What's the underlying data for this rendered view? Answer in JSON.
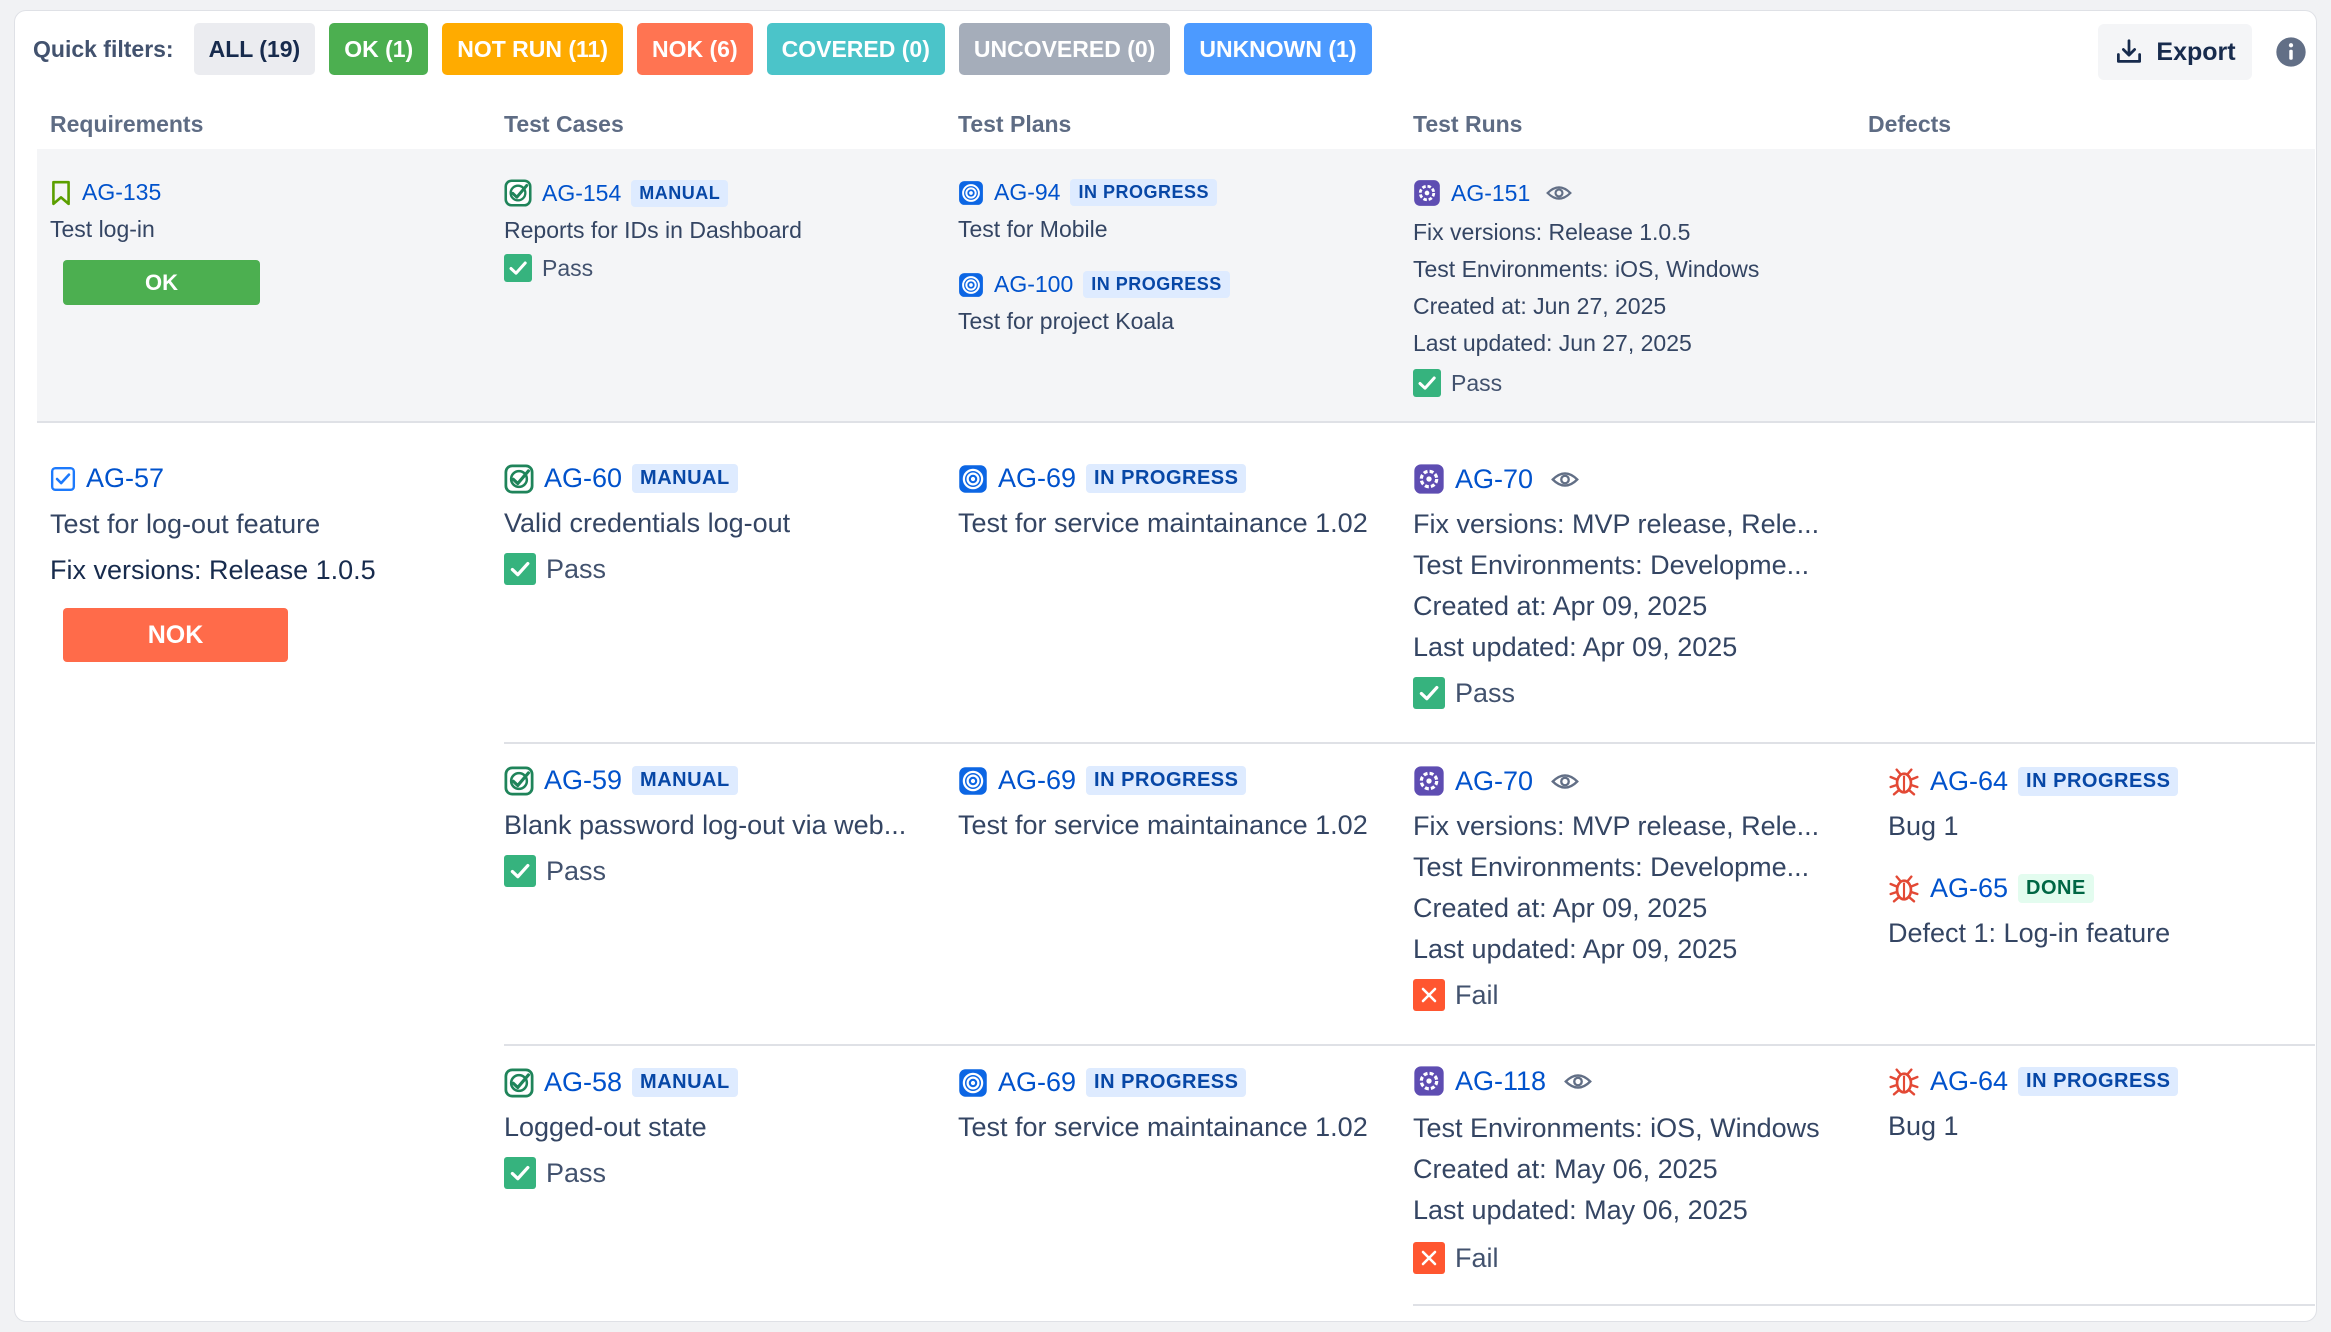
{
  "filters": {
    "label": "Quick filters:",
    "chips": [
      {
        "label": "ALL (19)",
        "color": "#ebecf0"
      },
      {
        "label": "OK (1)",
        "color": "#4caf50"
      },
      {
        "label": "NOT RUN (11)",
        "color": "#ffab00"
      },
      {
        "label": "NOK (6)",
        "color": "#ff7452"
      },
      {
        "label": "COVERED (0)",
        "color": "#4bc4c9"
      },
      {
        "label": "UNCOVERED (0)",
        "color": "#a5adba"
      },
      {
        "label": "UNKNOWN (1)",
        "color": "#4c9aff"
      }
    ],
    "export_label": "Export"
  },
  "columns": [
    "Requirements",
    "Test Cases",
    "Test Plans",
    "Test Runs",
    "Defects"
  ],
  "rows": [
    {
      "requirement": {
        "key": "AG-135",
        "title": "Test log-in",
        "status": "OK"
      },
      "test_case": {
        "key": "AG-154",
        "type": "MANUAL",
        "title": "Reports for IDs in Dashboard",
        "result": "Pass"
      },
      "plans": [
        {
          "key": "AG-94",
          "status": "IN PROGRESS",
          "title": "Test for Mobile"
        },
        {
          "key": "AG-100",
          "status": "IN PROGRESS",
          "title": "Test for project Koala"
        }
      ],
      "run": {
        "key": "AG-151",
        "lines": [
          "Fix versions: Release 1.0.5",
          "Test Environments: iOS, Windows",
          "Created at: Jun 27, 2025",
          "Last updated: Jun 27, 2025"
        ],
        "result": "Pass"
      }
    },
    {
      "requirement": {
        "key": "AG-57",
        "title": "Test for log-out feature",
        "fix": "Fix versions: Release 1.0.5",
        "status": "NOK"
      },
      "test_case": {
        "key": "AG-60",
        "type": "MANUAL",
        "title": "Valid credentials log-out",
        "result": "Pass"
      },
      "plan": {
        "key": "AG-69",
        "status": "IN PROGRESS",
        "title": "Test for service maintainance 1.02"
      },
      "run": {
        "key": "AG-70",
        "lines": [
          "Fix versions: MVP release, Rele...",
          "Test Environments: Developme...",
          "Created at: Apr 09, 2025",
          "Last updated: Apr 09, 2025"
        ],
        "result": "Pass"
      }
    },
    {
      "test_case": {
        "key": "AG-59",
        "type": "MANUAL",
        "title": "Blank password log-out via web...",
        "result": "Pass"
      },
      "plan": {
        "key": "AG-69",
        "status": "IN PROGRESS",
        "title": "Test for service maintainance 1.02"
      },
      "run": {
        "key": "AG-70",
        "lines": [
          "Fix versions: MVP release, Rele...",
          "Test Environments: Developme...",
          "Created at: Apr 09, 2025",
          "Last updated: Apr 09, 2025"
        ],
        "result": "Fail"
      },
      "defects": [
        {
          "key": "AG-64",
          "status": "IN PROGRESS",
          "title": "Bug 1"
        },
        {
          "key": "AG-65",
          "status": "DONE",
          "title": "Defect 1: Log-in feature"
        }
      ]
    },
    {
      "test_case": {
        "key": "AG-58",
        "type": "MANUAL",
        "title": "Logged-out state",
        "result": "Pass"
      },
      "plan": {
        "key": "AG-69",
        "status": "IN PROGRESS",
        "title": "Test for service maintainance 1.02"
      },
      "run": {
        "key": "AG-118",
        "lines": [
          "Test Environments: iOS, Windows",
          "Created at: May 06, 2025",
          "Last updated: May 06, 2025"
        ],
        "result": "Fail"
      },
      "defects": [
        {
          "key": "AG-64",
          "status": "IN PROGRESS",
          "title": "Bug 1"
        }
      ]
    }
  ]
}
